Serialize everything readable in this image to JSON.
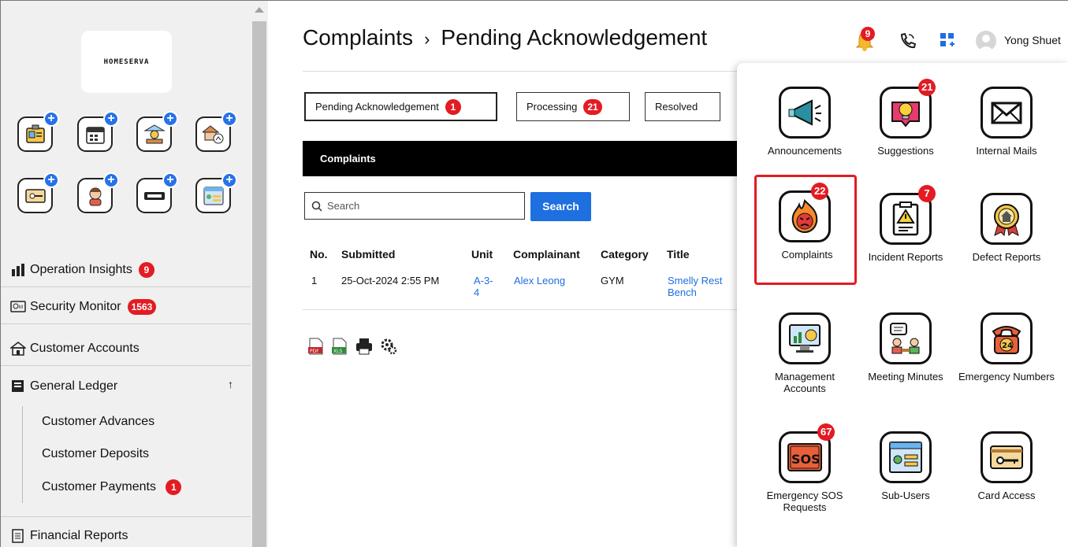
{
  "sidebar": {
    "logo_text": "HOMESERVA",
    "quick_icons": [
      "id-card-icon",
      "calendar-icon",
      "bank-icon",
      "house-finance-icon",
      "key-card-icon",
      "person-icon",
      "license-plate-icon",
      "login-form-icon"
    ],
    "menu": [
      {
        "label": "Operation Insights",
        "badge": "9",
        "icon": "bar-chart-icon"
      },
      {
        "label": "Security Monitor",
        "badge": "1563",
        "icon": "cctv-icon"
      },
      {
        "label": "Customer Accounts",
        "icon": "home-icon"
      },
      {
        "label": "General Ledger",
        "icon": "ledger-icon",
        "expand_symbol": "↑"
      },
      {
        "label": "Financial Reports",
        "icon": "report-icon"
      }
    ],
    "sub_menu": [
      {
        "label": "Customer Advances"
      },
      {
        "label": "Customer Deposits"
      },
      {
        "label": "Customer Payments",
        "badge": "1"
      }
    ]
  },
  "header": {
    "breadcrumb_root": "Complaints",
    "breadcrumb_sep": "›",
    "breadcrumb_current": "Pending Acknowledgement",
    "bell_badge": "9",
    "user_name": "Yong Shuet"
  },
  "tabs": [
    {
      "label": "Pending Acknowledgement",
      "badge": "1"
    },
    {
      "label": "Processing",
      "badge": "21"
    },
    {
      "label": "Resolved"
    }
  ],
  "section_title": "Complaints",
  "search": {
    "placeholder": "Search",
    "button_label": "Search"
  },
  "table": {
    "headers": [
      "No.",
      "Submitted",
      "Unit",
      "Complainant",
      "Category",
      "Title"
    ],
    "rows": [
      {
        "no": "1",
        "submitted": "25-Oct-2024 2:55 PM",
        "unit_line1": "A-3-",
        "unit_line2": "4",
        "complainant": "Alex Leong",
        "category": "GYM",
        "title_line1": "Smelly Rest",
        "title_line2": "Bench"
      }
    ]
  },
  "export_icons": [
    "pdf-icon",
    "xls-icon",
    "print-icon",
    "settings-icon"
  ],
  "panel": {
    "tiles": [
      {
        "label": "Announcements",
        "icon": "megaphone-icon"
      },
      {
        "label": "Suggestions",
        "icon": "lightbulb-icon",
        "badge": "21"
      },
      {
        "label": "Internal Mails",
        "icon": "mail-icon"
      },
      {
        "label": "Complaints",
        "icon": "angry-fire-icon",
        "badge": "22"
      },
      {
        "label": "Incident Reports",
        "icon": "warning-clipboard-icon",
        "badge": "7"
      },
      {
        "label": "Defect Reports",
        "icon": "house-badge-icon"
      },
      {
        "label": "Management Accounts",
        "icon": "accounts-monitor-icon"
      },
      {
        "label": "Meeting Minutes",
        "icon": "meeting-icon"
      },
      {
        "label": "Emergency Numbers",
        "icon": "emergency-phone-icon"
      },
      {
        "label": "Emergency SOS Requests",
        "icon": "sos-icon",
        "badge": "67"
      },
      {
        "label": "Sub-Users",
        "icon": "login-form-icon"
      },
      {
        "label": "Card Access",
        "icon": "key-card-icon"
      }
    ]
  },
  "colors": {
    "accent": "#1e6fe0",
    "badge": "#e31b23",
    "plus": "#2672e8"
  }
}
